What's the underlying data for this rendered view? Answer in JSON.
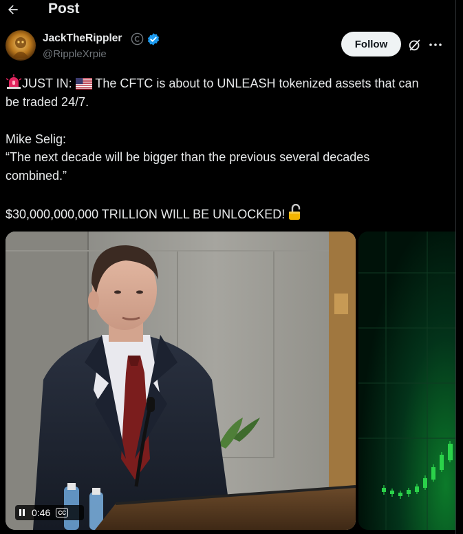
{
  "header": {
    "title": "Post",
    "back_icon": "arrow-left-icon"
  },
  "author": {
    "name": "JackTheRippler",
    "handle": "@RippleXrpie",
    "badges": [
      "copyright-circle-icon",
      "verified-badge-icon"
    ],
    "verified_color": "#1d9bf0"
  },
  "actions": {
    "follow_label": "Follow",
    "grok_icon": "grok-icon",
    "more_icon": "more-dots-icon"
  },
  "tweet": {
    "line1": "JUST IN: ",
    "line1b": " The CFTC is about to UNLEASH tokenized assets that can",
    "line2": "be traded 24/7.",
    "line3": "Mike Selig:",
    "line4": "“The next decade will be bigger than the previous several decades",
    "line5": "combined.”",
    "line6": "$30,000,000,000 TRILLION WILL BE UNLOCKED! ",
    "emojis": [
      "siren-icon",
      "us-flag-icon",
      "open-lock-icon"
    ]
  },
  "media": {
    "video_time": "0:46",
    "cc_label": "CC",
    "pause_icon": "pause-icon",
    "side_image": "green-candlestick-chart-icon"
  },
  "colors": {
    "background": "#000000",
    "text": "#e7e9ea",
    "muted": "#71767b",
    "follow_bg": "#eff3f4",
    "chart_green": "#2bd34a"
  }
}
